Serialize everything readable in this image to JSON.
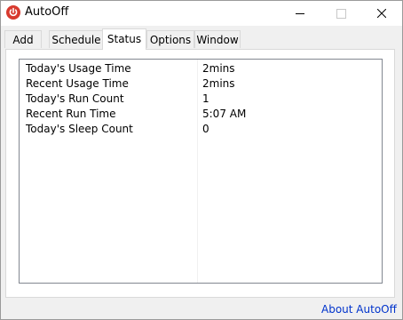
{
  "window": {
    "title": "AutoOff",
    "icon": "power-icon"
  },
  "tabs": [
    {
      "label": "Add",
      "active": false
    },
    {
      "label": "Schedule",
      "active": false
    },
    {
      "label": "Status",
      "active": true
    },
    {
      "label": "Options",
      "active": false
    },
    {
      "label": "Window",
      "active": false
    }
  ],
  "status_list": {
    "rows": [
      {
        "label": "Today's Usage Time",
        "value": "2mins"
      },
      {
        "label": "Recent Usage Time",
        "value": "2mins"
      },
      {
        "label": "Today's Run Count",
        "value": "1"
      },
      {
        "label": "Recent Run Time",
        "value": "5:07 AM"
      },
      {
        "label": "Today's Sleep Count",
        "value": "0"
      }
    ]
  },
  "footer": {
    "about_link": "About AutoOff"
  },
  "colors": {
    "link": "#0033cc",
    "icon": "#d83a2e"
  }
}
